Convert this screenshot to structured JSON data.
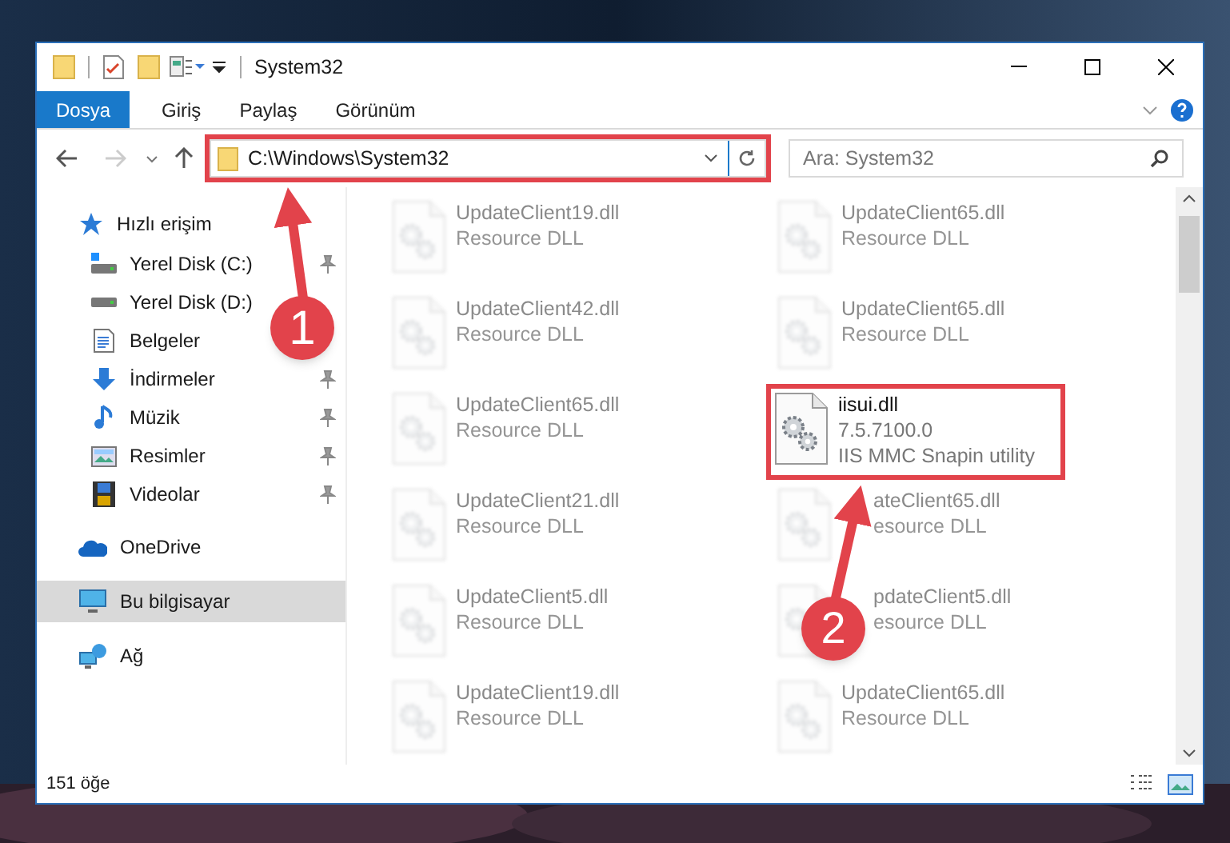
{
  "window": {
    "title": "System32"
  },
  "ribbon_tabs": [
    {
      "label": "Dosya",
      "selected": true
    },
    {
      "label": "Giriş",
      "selected": false
    },
    {
      "label": "Paylaş",
      "selected": false
    },
    {
      "label": "Görünüm",
      "selected": false
    }
  ],
  "address": {
    "value": "C:\\Windows\\System32"
  },
  "search": {
    "placeholder": "Ara: System32"
  },
  "sidebar": {
    "items": [
      {
        "label": "Hızlı erişim",
        "kind": "quick",
        "selected": false,
        "children": [
          {
            "label": "Yerel Disk (C:)",
            "kind": "drive_c",
            "pinned": true
          },
          {
            "label": "Yerel Disk (D:)",
            "kind": "drive",
            "pinned": false
          },
          {
            "label": "Belgeler",
            "kind": "docs",
            "pinned": false
          },
          {
            "label": "İndirmeler",
            "kind": "downloads",
            "pinned": true
          },
          {
            "label": "Müzik",
            "kind": "music",
            "pinned": true
          },
          {
            "label": "Resimler",
            "kind": "pictures",
            "pinned": true
          },
          {
            "label": "Videolar",
            "kind": "videos",
            "pinned": true
          }
        ]
      },
      {
        "label": "OneDrive",
        "kind": "cloud",
        "selected": false
      },
      {
        "label": "Bu bilgisayar",
        "kind": "pc",
        "selected": true
      },
      {
        "label": "Ağ",
        "kind": "network",
        "selected": false
      }
    ]
  },
  "files": [
    {
      "name": "UpdateClient19.dll",
      "detail": "Resource DLL",
      "blurred": true,
      "covered": false
    },
    {
      "name": "UpdateClient65.dll",
      "detail": "Resource DLL",
      "blurred": true,
      "covered": false
    },
    {
      "name": "UpdateClient42.dll",
      "detail": "Resource DLL",
      "blurred": true,
      "covered": false
    },
    {
      "name": "UpdateClient65.dll",
      "detail": "Resource DLL",
      "blurred": true,
      "covered": false
    },
    {
      "name": "UpdateClient65.dll",
      "detail": "Resource DLL",
      "blurred": true,
      "covered": false
    },
    {
      "name": "iisui.dll",
      "version": "7.5.7100.0",
      "detail": "IIS MMC Snapin utility",
      "blurred": false,
      "covered": false
    },
    {
      "name": "UpdateClient21.dll",
      "detail": "Resource DLL",
      "blurred": true,
      "covered": false
    },
    {
      "name": "ateClient65.dll",
      "detail": "esource DLL",
      "blurred": true,
      "covered": true
    },
    {
      "name": "UpdateClient5.dll",
      "detail": "Resource DLL",
      "blurred": true,
      "covered": false
    },
    {
      "name": "pdateClient5.dll",
      "detail": "esource DLL",
      "blurred": true,
      "covered": true
    },
    {
      "name": "UpdateClient19.dll",
      "detail": "Resource DLL",
      "blurred": true,
      "covered": false
    },
    {
      "name": "UpdateClient65.dll",
      "detail": "Resource DLL",
      "blurred": true,
      "covered": false
    }
  ],
  "status_bar": {
    "count": "151 öğe"
  },
  "annotations": [
    {
      "number": "1"
    },
    {
      "number": "2"
    }
  ]
}
